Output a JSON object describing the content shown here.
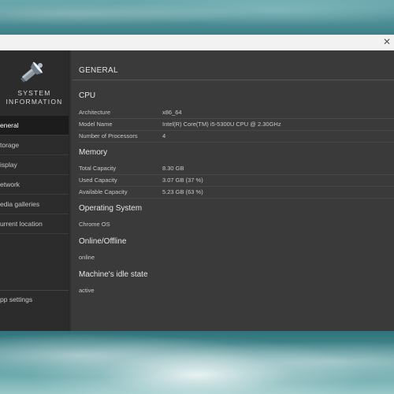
{
  "app": {
    "name_line1": "SYSTEM",
    "name_line2": "INFORMATION",
    "close_glyph": "✕"
  },
  "sidebar": {
    "items": [
      {
        "label": "eneral",
        "active": true
      },
      {
        "label": "torage",
        "active": false
      },
      {
        "label": "isplay",
        "active": false
      },
      {
        "label": "etwork",
        "active": false
      },
      {
        "label": "edia galleries",
        "active": false
      },
      {
        "label": "urrent location",
        "active": false
      }
    ],
    "settings_label": "pp settings"
  },
  "main": {
    "title": "GENERAL",
    "cpu": {
      "heading": "CPU",
      "rows": [
        {
          "key": "Architecture",
          "value": "x86_64"
        },
        {
          "key": "Model Name",
          "value": "Intel(R) Core(TM) i5-5300U CPU @ 2.30GHz"
        },
        {
          "key": "Number of Processors",
          "value": "4"
        }
      ]
    },
    "memory": {
      "heading": "Memory",
      "rows": [
        {
          "key": "Total Capacity",
          "value": "8.30 GB"
        },
        {
          "key": "Used Capacity",
          "value": "3.07 GB (37 %)"
        },
        {
          "key": "Available Capacity",
          "value": "5.23 GB (63 %)"
        }
      ]
    },
    "os": {
      "heading": "Operating System",
      "value": "Chrome OS"
    },
    "online": {
      "heading": "Online/Offline",
      "value": "online"
    },
    "idle": {
      "heading": "Machine's idle state",
      "value": "active"
    }
  },
  "colors": {
    "sidebar_bg": "#2c2c2c",
    "active_item_bg": "#1c1c1c",
    "main_bg": "#3a3a3a",
    "titlebar_bg": "#f2f2f2"
  }
}
